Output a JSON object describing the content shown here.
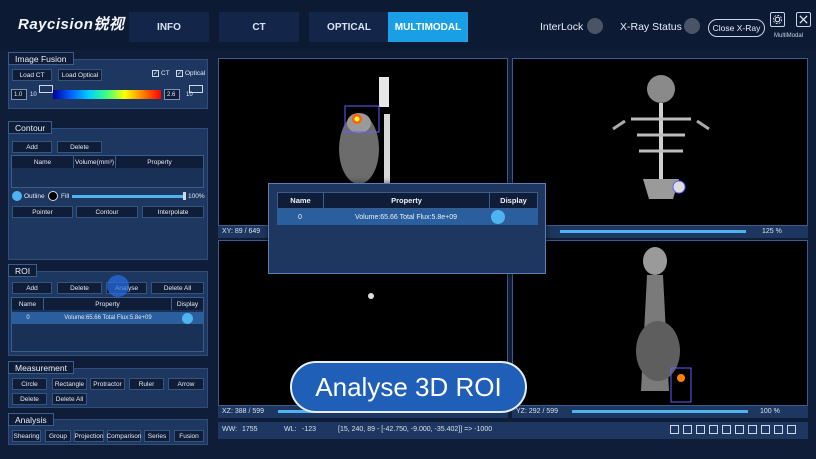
{
  "header": {
    "logo": "Raycision锐视",
    "tabs": [
      {
        "label": "INFO",
        "active": false
      },
      {
        "label": "CT",
        "active": false
      },
      {
        "label": "OPTICAL",
        "active": false
      },
      {
        "label": "MULTIMODAL",
        "active": true
      }
    ],
    "interlock_label": "InterLock",
    "xray_status_label": "X-Ray Status",
    "close_xray_label": "Close X-Ray",
    "mode_label": "MultiModal"
  },
  "image_fusion": {
    "title": "Image Fusion",
    "load_ct": "Load CT",
    "load_optical": "Load Optical",
    "ct_check_label": "CT",
    "optical_check_label": "Optical",
    "ct_min": "1.0",
    "ct_max": "10",
    "optical_min": "2.6",
    "optical_max": "10"
  },
  "contour": {
    "title": "Contour",
    "add": "Add",
    "delete": "Delete",
    "columns": [
      "Name",
      "Volume(mm³)",
      "Property"
    ],
    "outline_label": "Outline",
    "fill_label": "Fill",
    "opacity": "100%",
    "pointer": "Pointer",
    "contour_btn": "Contour",
    "interpolate": "Interpolate"
  },
  "roi": {
    "title": "ROI",
    "add": "Add",
    "delete": "Delete",
    "analyse": "Analyse",
    "delete_all": "Delete All",
    "columns": [
      "Name",
      "Property",
      "Display"
    ],
    "rows": [
      {
        "name": "0",
        "property": "Volume:65.66 Total Flux:5.8e+09"
      }
    ]
  },
  "measurement": {
    "title": "Measurement",
    "tools": [
      "Circle",
      "Rectangle",
      "Protractor",
      "Ruler",
      "Arrow",
      "Delete",
      "Delete All"
    ]
  },
  "analysis": {
    "title": "Analysis",
    "tools": [
      "Shearing",
      "Group",
      "Projection",
      "Comparison",
      "Series",
      "Fusion"
    ]
  },
  "viewports": {
    "top_left_coord": "XY:  89 / 649",
    "top_right_zoom": "125 %",
    "bottom_left_coord": "XZ:  388 / 599",
    "bottom_right_coord": "YZ:  292 / 599",
    "bottom_right_zoom": "100 %"
  },
  "status_bar": {
    "ww_label": "WW:",
    "ww_value": "1755",
    "wl_label": "WL:",
    "wl_value": "-123",
    "info": "[15, 240, 89 - [-42.750, -9.000, -35.402]] => -1000"
  },
  "roi_popup": {
    "columns": [
      "Name",
      "Property",
      "Display"
    ],
    "row": {
      "name": "0",
      "property": "Volume:65.66 Total Flux:5.8e+09"
    }
  },
  "caption": "Analyse 3D ROI",
  "colors": {
    "accent": "#1a9fe6",
    "panel": "#1e3760",
    "selected_row": "#2a5e9c",
    "toggle": "#4fb3ef"
  }
}
